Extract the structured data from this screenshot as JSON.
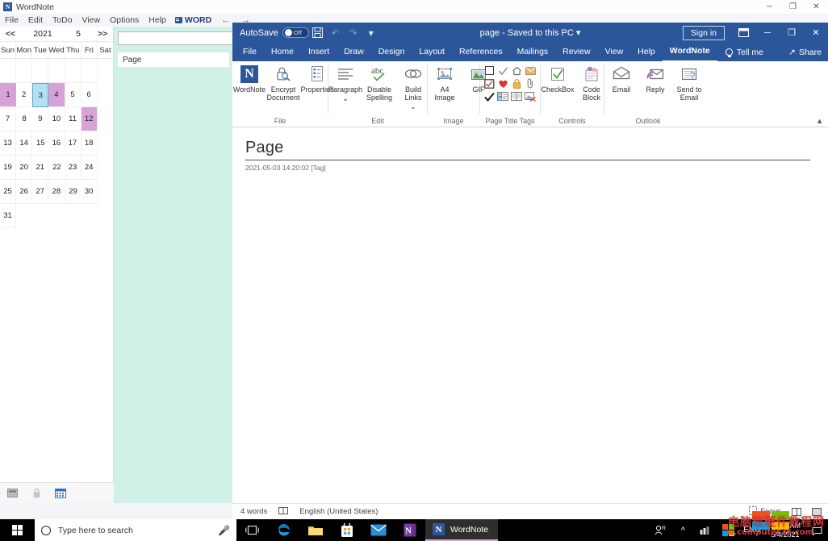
{
  "outer_window": {
    "app_title": "WordNote",
    "logo_letter": "N",
    "menus": [
      "File",
      "Edit",
      "ToDo",
      "View",
      "Options",
      "Help"
    ],
    "word_chip_label": "WORD",
    "nav_back": "←",
    "nav_forward": "→",
    "window_controls": {
      "minimize": "─",
      "maximize": "❐",
      "close": "✕"
    }
  },
  "calendar": {
    "prev_label": "<<",
    "next_label": ">>",
    "year": "2021",
    "month": "5",
    "day_headers": [
      "Sun",
      "Mon",
      "Tue",
      "Wed",
      "Thu",
      "Fri",
      "Sat"
    ],
    "leading_blanks": 6,
    "days": [
      1,
      2,
      3,
      4,
      5,
      6,
      7,
      8,
      9,
      10,
      11,
      12,
      13,
      14,
      15,
      16,
      17,
      18,
      19,
      20,
      21,
      22,
      23,
      24,
      25,
      26,
      27,
      28,
      29,
      30,
      31
    ],
    "selected_day": 3,
    "marked_days": [
      1,
      4,
      12
    ],
    "colors": {
      "selected_fill": "#b3e0f2",
      "selected_border": "#5aaacd",
      "marked_fill": "#d8a1d8"
    },
    "footer_icons": [
      "note-icon",
      "lock-icon",
      "calendar-icon"
    ]
  },
  "page_list": {
    "search_value": "",
    "search_placeholder": "",
    "clear_label": "✕",
    "add_page_icon": "plus-circle-icon",
    "items": [
      {
        "title": "Page"
      }
    ],
    "panel_color": "#d1f0e7"
  },
  "word": {
    "titlebar": {
      "autosave_label": "AutoSave",
      "autosave_state": "Off",
      "save_icon": "save-icon",
      "undo_icon": "undo-icon",
      "redo_icon": "redo-icon",
      "customize_icon": "customize-qat-icon",
      "document_name": "page  -  Saved to this PC",
      "dropdown_caret": "▾",
      "signin_label": "Sign in",
      "ribbon_display_icon": "ribbon-display-options-icon",
      "minimize": "─",
      "maximize": "❐",
      "close": "✕"
    },
    "tabs": [
      {
        "label": "File",
        "active": false
      },
      {
        "label": "Home",
        "active": false
      },
      {
        "label": "Insert",
        "active": false
      },
      {
        "label": "Draw",
        "active": false
      },
      {
        "label": "Design",
        "active": false
      },
      {
        "label": "Layout",
        "active": false
      },
      {
        "label": "References",
        "active": false
      },
      {
        "label": "Mailings",
        "active": false
      },
      {
        "label": "Review",
        "active": false
      },
      {
        "label": "View",
        "active": false
      },
      {
        "label": "Help",
        "active": false
      },
      {
        "label": "WordNote",
        "active": true
      }
    ],
    "tell_me": "Tell me",
    "share": "Share",
    "ribbon_groups": [
      {
        "name": "File",
        "buttons": [
          {
            "label": "WordNote",
            "icon": "wordnote-n-icon"
          },
          {
            "label": "Encrypt Document",
            "icon": "lock-magnifier-icon"
          },
          {
            "label": "Properties",
            "icon": "properties-list-icon"
          }
        ]
      },
      {
        "name": "Edit",
        "buttons": [
          {
            "label": "Paragraph",
            "icon": "paragraph-lines-icon",
            "caret": "⌄"
          },
          {
            "label": "Disable Spelling",
            "icon": "abc-check-icon"
          },
          {
            "label": "Build Links",
            "icon": "chain-links-icon",
            "caret": "⌄"
          }
        ]
      },
      {
        "name": "Image",
        "buttons": [
          {
            "label": "A4 Image",
            "icon": "picture-frame-icon"
          },
          {
            "label": "GIF",
            "icon": "gif-picture-icon"
          }
        ]
      },
      {
        "name": "Page Title Tags",
        "tags": [
          "empty-checkbox-icon",
          "grey-check-icon",
          "home-icon",
          "envelope-tan-icon",
          "red-checkbox-icon",
          "red-heart-icon",
          "padlock-icon",
          "paperclip-icon",
          "black-check-icon",
          "contact-card-icon",
          "book-icon",
          "no-image-icon"
        ]
      },
      {
        "name": "Controls",
        "buttons": [
          {
            "label": "CheckBox",
            "icon": "checkbox-green-icon"
          },
          {
            "label": "Code Block",
            "icon": "code-block-icon"
          }
        ]
      },
      {
        "name": "Outlook",
        "buttons": [
          {
            "label": "Email",
            "icon": "envelope-open-icon"
          },
          {
            "label": "Reply",
            "icon": "reply-envelope-icon"
          },
          {
            "label": "Send to Email",
            "icon": "send-to-email-icon"
          }
        ]
      }
    ],
    "ribbon_collapse_icon": "collapse-ribbon-chevron-icon",
    "document": {
      "heading": "Page",
      "meta": "2021-05-03 14:20:02  [Tag]"
    },
    "status_bar": {
      "word_count": "4 words",
      "proofing_icon": "proofing-icon",
      "language": "English (United States)",
      "focus_label": "Focus",
      "focus_icon": "focus-mode-icon",
      "view_read_icon": "read-mode-icon",
      "view_print_icon": "print-layout-icon"
    }
  },
  "taskbar": {
    "start_icon": "windows-start-icon",
    "search_placeholder": "Type here to search",
    "search_circle_icon": "cortana-circle-icon",
    "mic_icon": "microphone-icon",
    "pinned": [
      {
        "icon": "task-view-icon",
        "name": "task-view"
      },
      {
        "icon": "edge-icon",
        "name": "microsoft-edge"
      },
      {
        "icon": "file-explorer-icon",
        "name": "file-explorer"
      },
      {
        "icon": "microsoft-store-icon",
        "name": "microsoft-store"
      },
      {
        "icon": "mail-icon",
        "name": "mail"
      },
      {
        "icon": "onenote-icon",
        "name": "onenote"
      }
    ],
    "active_app": {
      "label": "WordNote",
      "icon": "wordnote-n-icon"
    },
    "tray": {
      "people_icon": "people-icon",
      "show_hidden_icon": "show-hidden-icons-chevron",
      "network_icon": "network-icon",
      "windows_security_icon": "windows-flag-icon",
      "language": "ENG",
      "time": "10:36 AM",
      "date": "5/4/2021",
      "notifications_icon": "action-center-icon"
    }
  },
  "watermark": {
    "text_cn": "电脑软硬件教程网",
    "text_url": "w.computer26.com",
    "color": "#e03a3a"
  }
}
